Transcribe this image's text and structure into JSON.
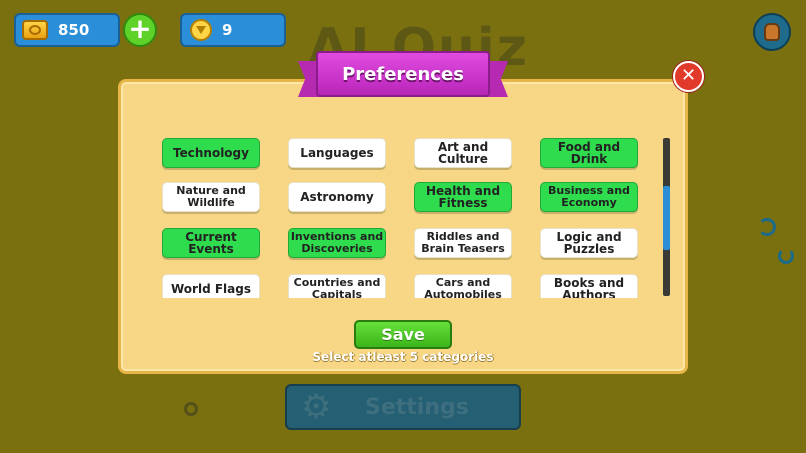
{
  "hud": {
    "coins": "850",
    "gems": "9"
  },
  "background": {
    "title": "AI Quiz",
    "settings_label": "Settings"
  },
  "dialog": {
    "title": "Preferences",
    "close_glyph": "✕",
    "save_label": "Save",
    "hint": "Select atleast 5 categories",
    "categories": [
      {
        "label": "Technology",
        "selected": true
      },
      {
        "label": "Languages",
        "selected": false
      },
      {
        "label": "Art and Culture",
        "selected": false
      },
      {
        "label": "Food and Drink",
        "selected": true
      },
      {
        "label": "Nature and Wildlife",
        "selected": false
      },
      {
        "label": "Astronomy",
        "selected": false
      },
      {
        "label": "Health and Fitness",
        "selected": true
      },
      {
        "label": "Business and Economy",
        "selected": true
      },
      {
        "label": "Current Events",
        "selected": true
      },
      {
        "label": "Inventions and Discoveries",
        "selected": true
      },
      {
        "label": "Riddles and Brain Teasers",
        "selected": false
      },
      {
        "label": "Logic and Puzzles",
        "selected": false
      },
      {
        "label": "World Flags",
        "selected": false
      },
      {
        "label": "Countries and Capitals",
        "selected": false
      },
      {
        "label": "Cars and Automobiles",
        "selected": false
      },
      {
        "label": "Books and Authors",
        "selected": false
      }
    ],
    "scroll_position": 0.35
  },
  "colors": {
    "selected": "#2fdc4e",
    "unselected": "#ffffff",
    "accent_banner": "#d33fd3",
    "save": "#4cc526"
  },
  "icons": {
    "coin": "coin-icon",
    "gem": "gem-icon",
    "plus": "plus-icon",
    "profile": "avatar-icon",
    "close": "close-icon",
    "gear": "gear-icon"
  }
}
